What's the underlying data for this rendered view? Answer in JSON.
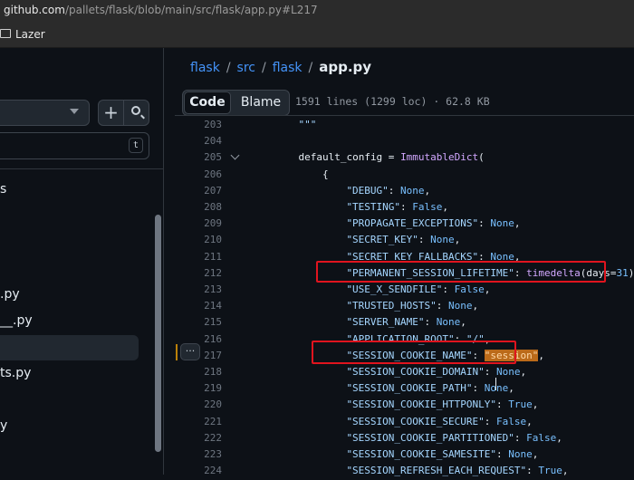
{
  "browser": {
    "url_host": "github.com",
    "url_path": "/pallets/flask/blob/main/src/flask/app.py#L217",
    "bookmark_folder": "Lazer"
  },
  "sidebar": {
    "add_icon": "plus-icon",
    "search_icon": "search-icon",
    "shortcut_key": "t",
    "tree_items": [
      {
        "label": "s"
      },
      {
        "label": ".py"
      },
      {
        "label": "__.py"
      },
      {
        "label": "ts.py"
      },
      {
        "label": "y"
      }
    ]
  },
  "breadcrumb": {
    "parts": [
      "flask",
      "src",
      "flask"
    ],
    "current": "app.py"
  },
  "file_header": {
    "tab_code": "Code",
    "tab_blame": "Blame",
    "stats": "1591 lines (1299 loc) · 62.8 KB",
    "line_menu": "···"
  },
  "code": {
    "highlighted_line": 217,
    "lines": [
      {
        "n": "203",
        "indent": 4,
        "tokens": [
          {
            "t": "\"\"\"",
            "c": "str"
          }
        ]
      },
      {
        "n": "204",
        "indent": 0,
        "tokens": []
      },
      {
        "n": "205",
        "indent": 4,
        "tokens": [
          {
            "t": "default_config = ",
            "c": ""
          },
          {
            "t": "ImmutableDict",
            "c": "fn"
          },
          {
            "t": "(",
            "c": ""
          }
        ]
      },
      {
        "n": "206",
        "indent": 8,
        "tokens": [
          {
            "t": "{",
            "c": ""
          }
        ]
      },
      {
        "n": "207",
        "indent": 12,
        "tokens": [
          {
            "t": "\"DEBUG\"",
            "c": "str"
          },
          {
            "t": ": ",
            "c": ""
          },
          {
            "t": "None",
            "c": "key"
          },
          {
            "t": ",",
            "c": ""
          }
        ]
      },
      {
        "n": "208",
        "indent": 12,
        "tokens": [
          {
            "t": "\"TESTING\"",
            "c": "str"
          },
          {
            "t": ": ",
            "c": ""
          },
          {
            "t": "False",
            "c": "key"
          },
          {
            "t": ",",
            "c": ""
          }
        ]
      },
      {
        "n": "209",
        "indent": 12,
        "tokens": [
          {
            "t": "\"PROPAGATE_EXCEPTIONS\"",
            "c": "str"
          },
          {
            "t": ": ",
            "c": ""
          },
          {
            "t": "None",
            "c": "key"
          },
          {
            "t": ",",
            "c": ""
          }
        ]
      },
      {
        "n": "210",
        "indent": 12,
        "tokens": [
          {
            "t": "\"SECRET_KEY\"",
            "c": "str"
          },
          {
            "t": ": ",
            "c": ""
          },
          {
            "t": "None",
            "c": "key"
          },
          {
            "t": ",",
            "c": ""
          }
        ]
      },
      {
        "n": "211",
        "indent": 12,
        "tokens": [
          {
            "t": "\"SECRET_KEY_FALLBACKS\"",
            "c": "str"
          },
          {
            "t": ": ",
            "c": ""
          },
          {
            "t": "None",
            "c": "key"
          },
          {
            "t": ",",
            "c": ""
          }
        ]
      },
      {
        "n": "212",
        "indent": 12,
        "tokens": [
          {
            "t": "\"PERMANENT_SESSION_LIFETIME\"",
            "c": "str"
          },
          {
            "t": ": ",
            "c": ""
          },
          {
            "t": "timedelta",
            "c": "fn"
          },
          {
            "t": "(days=",
            "c": ""
          },
          {
            "t": "31",
            "c": "key"
          },
          {
            "t": "),",
            "c": ""
          }
        ]
      },
      {
        "n": "213",
        "indent": 12,
        "tokens": [
          {
            "t": "\"USE_X_SENDFILE\"",
            "c": "str"
          },
          {
            "t": ": ",
            "c": ""
          },
          {
            "t": "False",
            "c": "key"
          },
          {
            "t": ",",
            "c": ""
          }
        ]
      },
      {
        "n": "214",
        "indent": 12,
        "tokens": [
          {
            "t": "\"TRUSTED_HOSTS\"",
            "c": "str"
          },
          {
            "t": ": ",
            "c": ""
          },
          {
            "t": "None",
            "c": "key"
          },
          {
            "t": ",",
            "c": ""
          }
        ]
      },
      {
        "n": "215",
        "indent": 12,
        "tokens": [
          {
            "t": "\"SERVER_NAME\"",
            "c": "str"
          },
          {
            "t": ": ",
            "c": ""
          },
          {
            "t": "None",
            "c": "key"
          },
          {
            "t": ",",
            "c": ""
          }
        ]
      },
      {
        "n": "216",
        "indent": 12,
        "tokens": [
          {
            "t": "\"APPLICATION_ROOT\"",
            "c": "str"
          },
          {
            "t": ": ",
            "c": ""
          },
          {
            "t": "\"/\"",
            "c": "str"
          },
          {
            "t": ",",
            "c": ""
          }
        ]
      },
      {
        "n": "217",
        "indent": 12,
        "tokens": [
          {
            "t": "\"SESSION_COOKIE_NAME\"",
            "c": "str"
          },
          {
            "t": ": ",
            "c": ""
          },
          {
            "t": "\"session\"",
            "c": "hl"
          },
          {
            "t": ",",
            "c": ""
          }
        ]
      },
      {
        "n": "218",
        "indent": 12,
        "tokens": [
          {
            "t": "\"SESSION_COOKIE_DOMAIN\"",
            "c": "str"
          },
          {
            "t": ": ",
            "c": ""
          },
          {
            "t": "None",
            "c": "key"
          },
          {
            "t": ",",
            "c": ""
          }
        ]
      },
      {
        "n": "219",
        "indent": 12,
        "tokens": [
          {
            "t": "\"SESSION_COOKIE_PATH\"",
            "c": "str"
          },
          {
            "t": ": ",
            "c": ""
          },
          {
            "t": "None",
            "c": "key"
          },
          {
            "t": ",",
            "c": ""
          }
        ]
      },
      {
        "n": "220",
        "indent": 12,
        "tokens": [
          {
            "t": "\"SESSION_COOKIE_HTTPONLY\"",
            "c": "str"
          },
          {
            "t": ": ",
            "c": ""
          },
          {
            "t": "True",
            "c": "key"
          },
          {
            "t": ",",
            "c": ""
          }
        ]
      },
      {
        "n": "221",
        "indent": 12,
        "tokens": [
          {
            "t": "\"SESSION_COOKIE_SECURE\"",
            "c": "str"
          },
          {
            "t": ": ",
            "c": ""
          },
          {
            "t": "False",
            "c": "key"
          },
          {
            "t": ",",
            "c": ""
          }
        ]
      },
      {
        "n": "222",
        "indent": 12,
        "tokens": [
          {
            "t": "\"SESSION_COOKIE_PARTITIONED\"",
            "c": "str"
          },
          {
            "t": ": ",
            "c": ""
          },
          {
            "t": "False",
            "c": "key"
          },
          {
            "t": ",",
            "c": ""
          }
        ]
      },
      {
        "n": "223",
        "indent": 12,
        "tokens": [
          {
            "t": "\"SESSION_COOKIE_SAMESITE\"",
            "c": "str"
          },
          {
            "t": ": ",
            "c": ""
          },
          {
            "t": "None",
            "c": "key"
          },
          {
            "t": ",",
            "c": ""
          }
        ]
      },
      {
        "n": "224",
        "indent": 12,
        "tokens": [
          {
            "t": "\"SESSION_REFRESH_EACH_REQUEST\"",
            "c": "str"
          },
          {
            "t": ": ",
            "c": ""
          },
          {
            "t": "True",
            "c": "key"
          },
          {
            "t": ",",
            "c": ""
          }
        ]
      }
    ]
  },
  "colors": {
    "background": "#0d1117",
    "link": "#4493f8",
    "string": "#a5d6ff",
    "keyword": "#79c0ff",
    "function": "#d2a8ff",
    "annotation": "#e0141e",
    "highlight": "#bb6a19"
  }
}
